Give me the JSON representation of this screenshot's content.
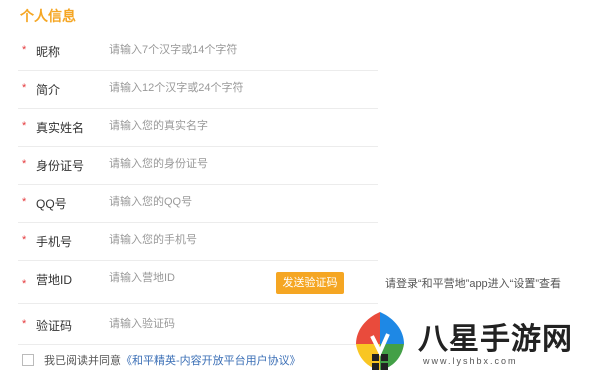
{
  "section_title": "个人信息",
  "fields": [
    {
      "label": "昵称",
      "placeholder": "请输入7个汉字或14个字符",
      "required": "*"
    },
    {
      "label": "简介",
      "placeholder": "请输入12个汉字或24个字符",
      "required": "*"
    },
    {
      "label": "真实姓名",
      "placeholder": "请输入您的真实名字",
      "required": "*"
    },
    {
      "label": "身份证号",
      "placeholder": "请输入您的身份证号",
      "required": "*"
    },
    {
      "label": "QQ号",
      "placeholder": "请输入您的QQ号",
      "required": "*"
    },
    {
      "label": "手机号",
      "placeholder": "请输入您的手机号",
      "required": "*"
    },
    {
      "label": "营地ID",
      "placeholder": "请输入营地ID",
      "required": "*"
    },
    {
      "label": "验证码",
      "placeholder": "请输入验证码",
      "required": "*"
    }
  ],
  "send_code_button": "发送验证码",
  "camp_hint": "请登录“和平营地”app进入“设置”查看",
  "agreement": {
    "prefix": "我已阅读并同意",
    "link": "《和平精英-内容开放平台用户协议》"
  },
  "watermark": {
    "name": "八星手游网",
    "url": "www.lyshbx.com"
  },
  "colors": {
    "accent": "#f5a623",
    "required": "#e4393c",
    "link": "#3b6fb6"
  }
}
